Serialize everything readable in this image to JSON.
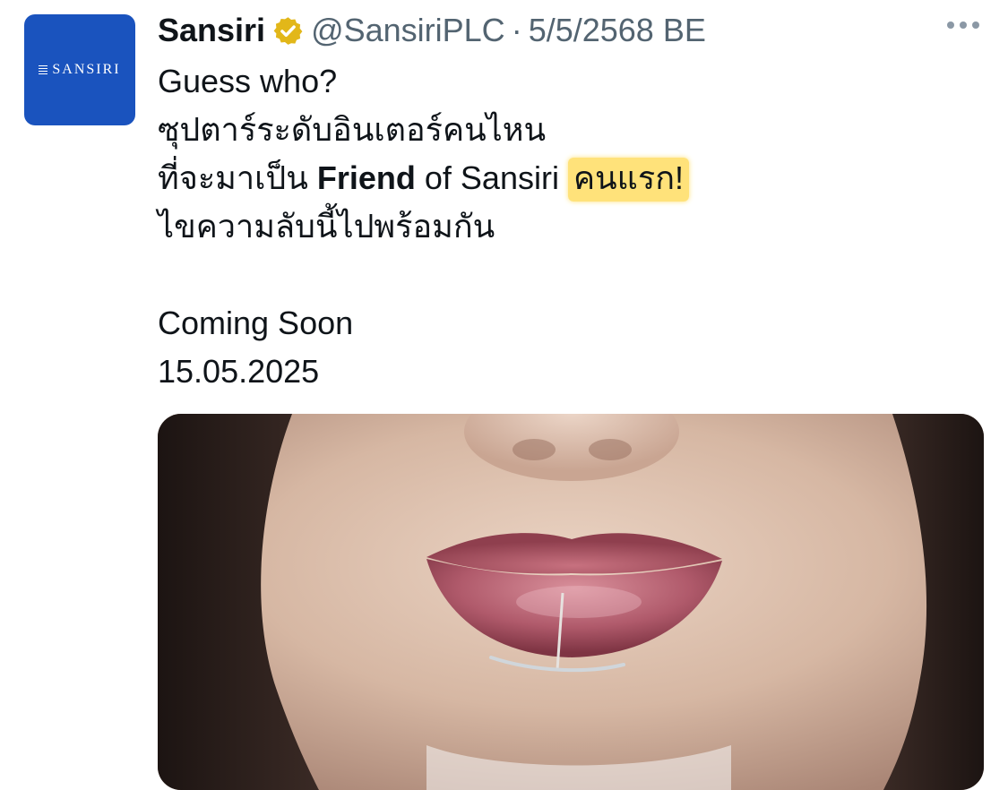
{
  "tweet": {
    "display_name": "Sansiri",
    "handle": "@SansiriPLC",
    "separator": "·",
    "date": "5/5/2568 BE",
    "avatar_text": "SANSIRI",
    "lines": {
      "l1": "Guess who?",
      "l2": "ซุปตาร์ระดับอินเตอร์คนไหน",
      "l3_pre": "ที่จะมาเป็น ",
      "l3_bold": "Friend",
      "l3_mid": " of Sansiri ",
      "l3_highlight": "คนแรก!",
      "l4": "ไขความลับนี้ไปพร้อมกัน",
      "l5": "Coming Soon",
      "l6": "15.05.2025"
    }
  },
  "colors": {
    "text": "#0f1419",
    "secondary": "#536471",
    "avatar_bg": "#1a53be",
    "verified_gold": "#e2b719",
    "highlight": "#ffe27a"
  },
  "icons": {
    "verified": "verified-badge-icon",
    "more": "more-options-icon"
  }
}
